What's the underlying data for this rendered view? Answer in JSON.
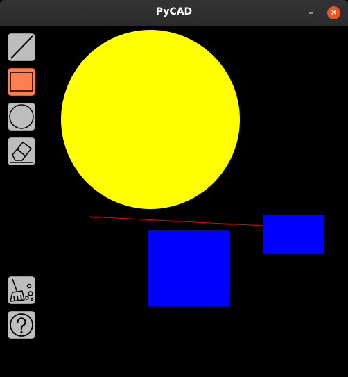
{
  "window": {
    "title": "PyCAD",
    "minimize_glyph": "–",
    "close_glyph": "✕",
    "close_color": "#e95420"
  },
  "toolbar": {
    "tools": [
      {
        "name": "line-tool",
        "icon": "diagonal-line-icon",
        "active": false
      },
      {
        "name": "rectangle-tool",
        "icon": "rectangle-icon",
        "active": true,
        "active_color": "#ff7f50"
      },
      {
        "name": "circle-tool",
        "icon": "circle-icon",
        "active": false
      },
      {
        "name": "eraser-tool",
        "icon": "eraser-icon",
        "active": false
      },
      {
        "name": "clear-tool",
        "icon": "broom-icon",
        "active": false
      },
      {
        "name": "help-tool",
        "icon": "question-mark-icon",
        "active": false
      }
    ]
  },
  "canvas": {
    "background": "#000000",
    "shapes": [
      {
        "type": "circle",
        "fill": "#ffff00"
      },
      {
        "type": "line",
        "stroke": "#ff0000"
      },
      {
        "type": "rectangle",
        "fill": "#0000ff"
      },
      {
        "type": "rectangle",
        "fill": "#0000ff"
      }
    ]
  }
}
